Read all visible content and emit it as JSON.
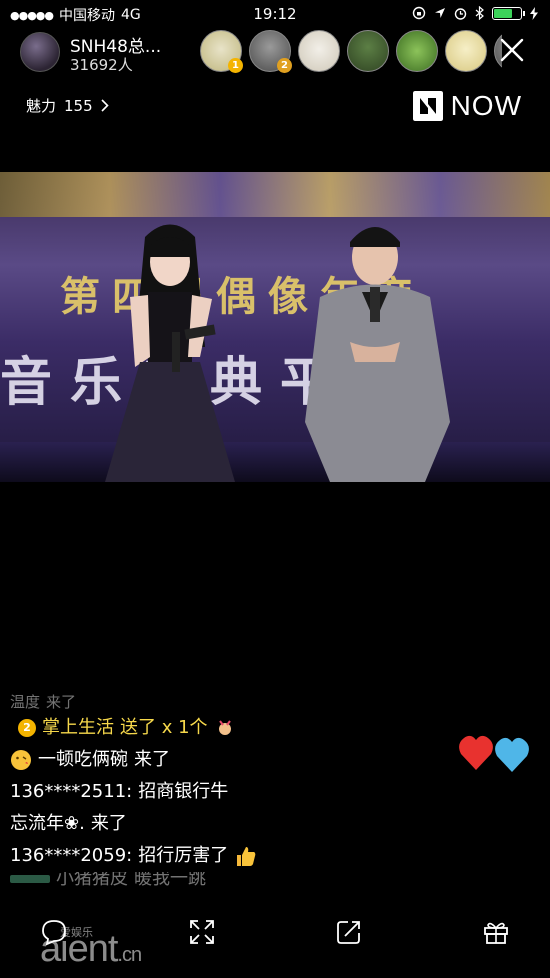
{
  "status_bar": {
    "carrier": "中国移动",
    "network": "4G",
    "time": "19:12",
    "battery_level": 0.7
  },
  "header": {
    "host_name": "SNH48总...",
    "host_count": "31692人",
    "viewer_ranks": [
      "1",
      "2"
    ],
    "charm_label": "魅力",
    "charm_value": "155",
    "brand": "NOW"
  },
  "video": {
    "banner_line1": "第四届偶像年度",
    "banner_line2": "音乐盛典平台"
  },
  "chat": {
    "lines": [
      {
        "user": "温度",
        "text": "来了"
      },
      {
        "badge": "2",
        "user": "掌上生活",
        "text": "送了 x 1个"
      },
      {
        "user": "一顿吃俩碗",
        "text": "来了"
      },
      {
        "user": "136****2511:",
        "text": "招商银行牛"
      },
      {
        "user": "忘流年❀.",
        "text": "来了"
      },
      {
        "user": "136****2059:",
        "text": "招行厉害了"
      },
      {
        "user": "小猪猪皮",
        "text": "暖我一跳"
      }
    ]
  },
  "watermark": {
    "main": "aient",
    "suffix": ".cn",
    "tag": "爱娱乐"
  },
  "colors": {
    "gift_text": "#f6d84b",
    "heart_red": "#e8322f",
    "heart_blue": "#4fb6e8",
    "battery": "#3cd35a"
  }
}
